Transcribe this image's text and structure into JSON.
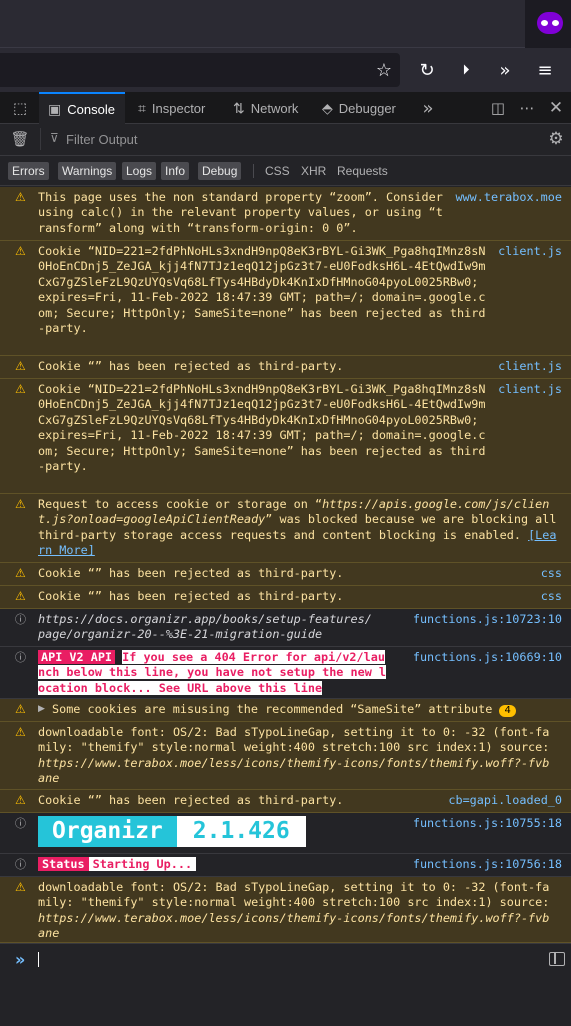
{
  "devtools": {
    "tabs": [
      {
        "label": "Console",
        "icon": "console-icon",
        "selected": true
      },
      {
        "label": "Inspector",
        "icon": "inspector-icon"
      },
      {
        "label": "Network",
        "icon": "network-icon"
      },
      {
        "label": "Debugger",
        "icon": "debugger-icon"
      }
    ],
    "filter_placeholder": "Filter Output",
    "levels": [
      {
        "label": "Errors",
        "on": true
      },
      {
        "label": "Warnings",
        "on": true
      },
      {
        "label": "Logs",
        "on": true
      },
      {
        "label": "Info",
        "on": true
      },
      {
        "label": "Debug",
        "on": true
      }
    ],
    "types": [
      "CSS",
      "XHR",
      "Requests"
    ]
  },
  "messages": {
    "m1": {
      "text": "This page uses the non standard property “zoom”. Consider using calc() in the relevant property values, or using “transform” along with “transform-origin: 0 0”.",
      "source": "www.terabox.moe"
    },
    "m2": {
      "text": "Cookie “NID=221=2fdPhNoHLs3xndH9npQ8eK3rBYL-Gi3WK_Pga8hqIMnz8sN0HoEnCDnj5_ZeJGA_kjj4fN7TJz1eqQ12jpGz3t7-eU0FodksH6L-4EtQwdIw9mCxG7gZSleFzL9QzUYQsVq68LfTys4HBdyDk4KnIxDfHMnoG04pyoL0025RBw0; expires=Fri, 11-Feb-2022 18:47:39 GMT; path=/; domain=.google.com; Secure; HttpOnly; SameSite=none” has been rejected as third-party.",
      "source": "client.js"
    },
    "m3": {
      "text": "Cookie “” has been rejected as third-party.",
      "source": "client.js"
    },
    "m4": {
      "text": "Cookie “NID=221=2fdPhNoHLs3xndH9npQ8eK3rBYL-Gi3WK_Pga8hqIMnz8sN0HoEnCDnj5_ZeJGA_kjj4fN7TJz1eqQ12jpGz3t7-eU0FodksH6L-4EtQwdIw9mCxG7gZSleFzL9QzUYQsVq68LfTys4HBdyDk4KnIxDfHMnoG04pyoL0025RBw0; expires=Fri, 11-Feb-2022 18:47:39 GMT; path=/; domain=.google.com; Secure; HttpOnly; SameSite=none” has been rejected as third-party.",
      "source": "client.js"
    },
    "m5": {
      "text_before": "Request to access cookie or storage on “",
      "url": "https://apis.google.com/js/client.js?onload=googleApiClientReady",
      "text_after": "” was blocked because we are blocking all third-party storage access requests and content blocking is enabled. ",
      "link": "[Learn More]"
    },
    "m6": {
      "text": "Cookie “” has been rejected as third-party.",
      "source": "css"
    },
    "m7": {
      "text": "Cookie “” has been rejected as third-party.",
      "source": "css"
    },
    "m8": {
      "text": "https://docs.organizr.app/books/setup-features/page/organizr-20--%3E-21-migration-guide",
      "source": "functions.js:10723:10"
    },
    "m9": {
      "tag": "API V2 API",
      "text": "If you see a 404 Error for api/v2/launch below this line, you have not setup the new location block... See URL above this line",
      "source": "functions.js:10669:10"
    },
    "m10": {
      "text": "Some cookies are misusing the recommended “SameSite” attribute",
      "count": "4"
    },
    "m11": {
      "text": "downloadable font: OS/2: Bad sTypoLineGap, setting it to 0: -32 (font-family: \"themify\" style:normal weight:400 stretch:100 src index:1) source: ",
      "url": "https://www.terabox.moe/less/icons/themify-icons/fonts/themify.woff?-fvbane"
    },
    "m12": {
      "text": "Cookie “” has been rejected as third-party.",
      "source": "cb=gapi.loaded_0"
    },
    "m13": {
      "name": "Organizr",
      "version": "2.1.426",
      "source": "functions.js:10755:18"
    },
    "m14": {
      "tag": "Status",
      "text": "Starting Up...",
      "source": "functions.js:10756:18"
    },
    "m15": {
      "text": "downloadable font: OS/2: Bad sTypoLineGap, setting it to 0: -32 (font-family: \"themify\" style:normal weight:400 stretch:100 src index:1) source: ",
      "url": "https://www.terabox.moe/less/icons/themify-icons/fonts/themify.woff?-fvbane"
    }
  }
}
